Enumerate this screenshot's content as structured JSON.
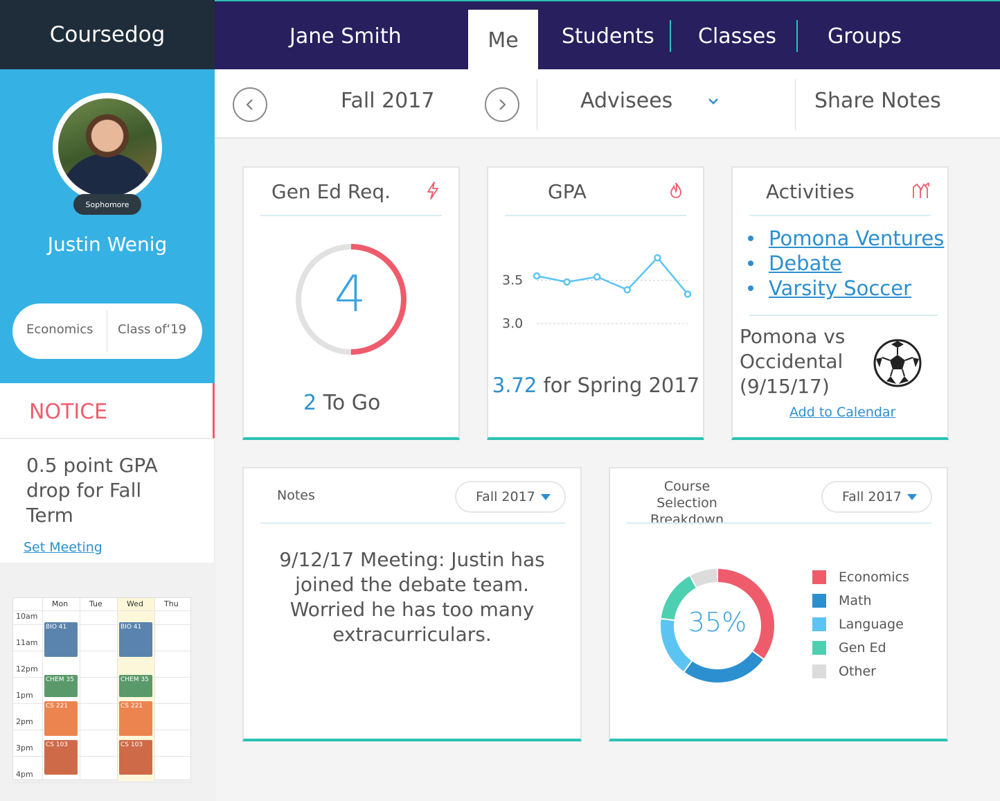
{
  "app": {
    "brand": "Coursedog"
  },
  "topnav": {
    "user": "Jane Smith",
    "tabs": [
      {
        "label": "Me",
        "active": true
      },
      {
        "label": "Students"
      },
      {
        "label": "Classes"
      },
      {
        "label": "Groups"
      }
    ]
  },
  "subbar": {
    "term": "Fall 2017",
    "advisees_label": "Advisees",
    "share_label": "Share Notes",
    "prev_icon": "chevron-left-icon",
    "next_icon": "chevron-right-icon"
  },
  "profile": {
    "badge": "Sophomore",
    "name": "Justin Wenig",
    "major": "Economics",
    "class_year": "Class of‘19"
  },
  "notice": {
    "title": "NOTICE",
    "message": "0.5 point GPA drop for Fall Term",
    "link": "Set Meeting"
  },
  "calendar": {
    "days": [
      "Mon",
      "Tue",
      "Wed",
      "Thu"
    ],
    "times": [
      "10am",
      "11am",
      "12pm",
      "1pm",
      "2pm",
      "3pm",
      "4pm"
    ],
    "events": [
      {
        "day": "Mon",
        "label": "BIO 41",
        "color": "#5a84ad"
      },
      {
        "day": "Wed",
        "label": "BIO 41",
        "color": "#5a84ad"
      },
      {
        "day": "Mon",
        "label": "CHEM 35",
        "color": "#5a9a6a"
      },
      {
        "day": "Wed",
        "label": "CHEM 35",
        "color": "#5a9a6a"
      },
      {
        "day": "Mon",
        "label": "CS 221",
        "color": "#ec8450"
      },
      {
        "day": "Wed",
        "label": "CS 221",
        "color": "#ec8450"
      },
      {
        "day": "Mon",
        "label": "CS 103",
        "color": "#cf6a48"
      },
      {
        "day": "Wed",
        "label": "CS 103",
        "color": "#cf6a48"
      }
    ]
  },
  "gened": {
    "title": "Gen Ed Req.",
    "icon": "lightning-icon",
    "remaining": "4",
    "progress": 0.5,
    "togo_num": "2",
    "togo_label": "To Go"
  },
  "gpa": {
    "title": "GPA",
    "icon": "flame-icon",
    "value": "3.72",
    "caption": "for Spring 2017",
    "chart_data": {
      "type": "line",
      "y_ticks": [
        "3.5",
        "3.0"
      ],
      "ylim": [
        2.8,
        4.0
      ],
      "values": [
        3.55,
        3.48,
        3.54,
        3.39,
        3.76,
        3.34
      ]
    }
  },
  "activities": {
    "title": "Activities",
    "icon": "trend-arrows-icon",
    "items": [
      "Pomona Ventures",
      "Debate",
      "Varsity Soccer"
    ],
    "event": "Pomona vs Occidental (9/15/17)",
    "event_icon": "soccer-ball-icon",
    "add_link": "Add to Calendar"
  },
  "notes": {
    "title": "Notes",
    "term": "Fall 2017",
    "body": "9/12/17 Meeting: Justin has joined the debate team. Worried he has too many extracurriculars."
  },
  "breakdown": {
    "title": "Course Selection Breakdown",
    "term": "Fall 2017",
    "center_label": "35%",
    "chart_data": {
      "type": "pie",
      "categories": [
        "Economics",
        "Math",
        "Language",
        "Gen Ed",
        "Other"
      ],
      "values": [
        35,
        25,
        17,
        15,
        8
      ],
      "colors": [
        "#ee5c6c",
        "#2c8fcf",
        "#5cc4f2",
        "#4dd0b0",
        "#dcdcdc"
      ]
    }
  }
}
